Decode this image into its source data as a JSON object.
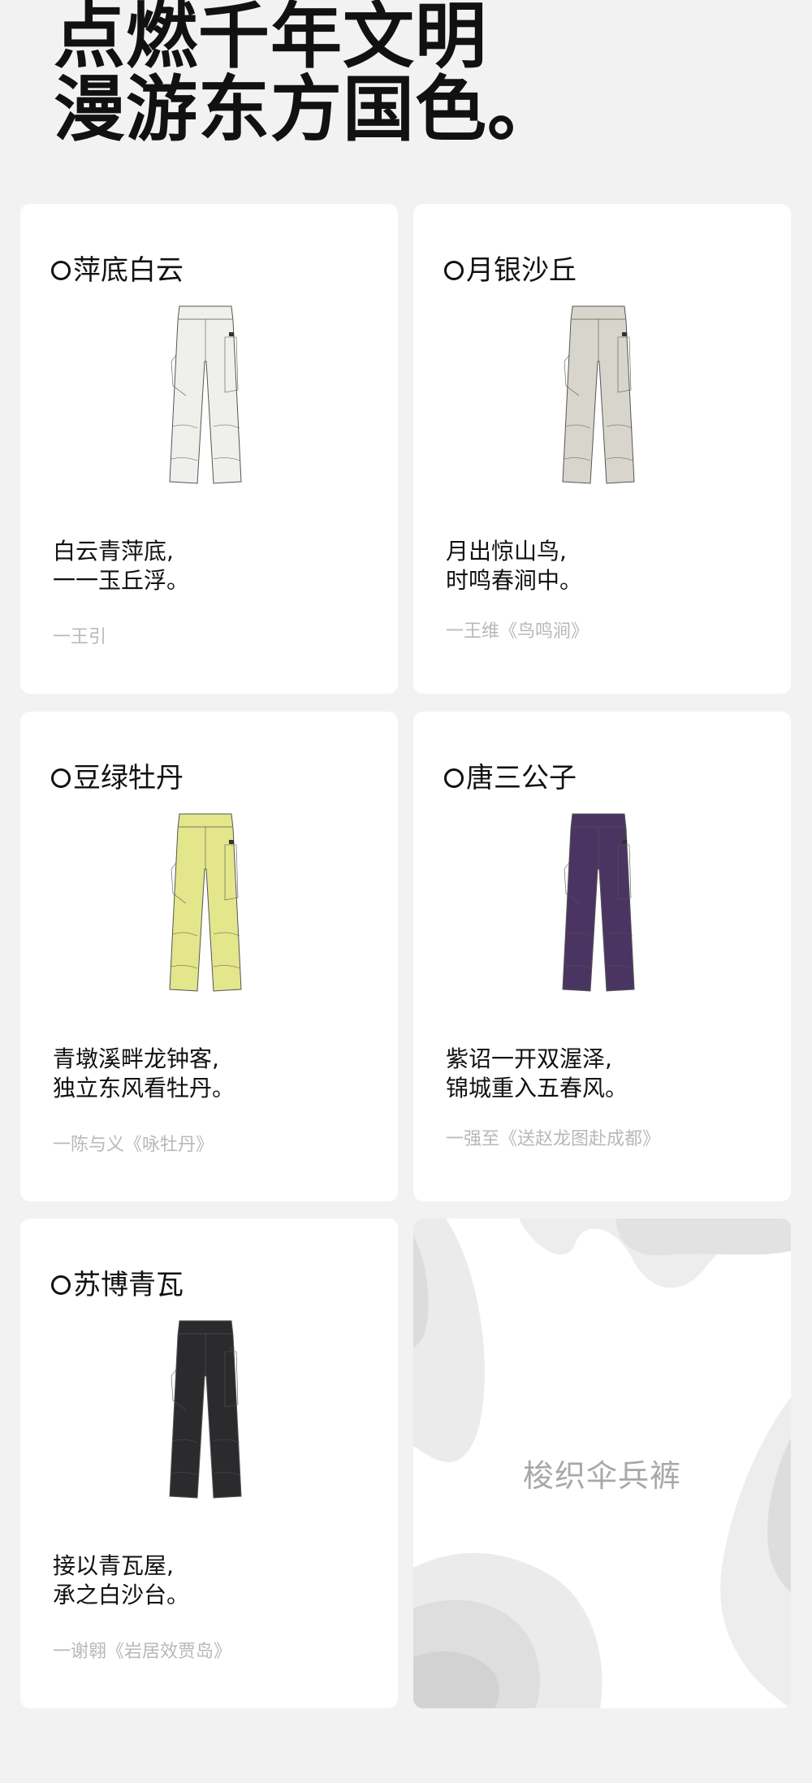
{
  "headline": {
    "line1": "点燃千年文明",
    "line2": "漫游东方国色。"
  },
  "cards": [
    {
      "title": "萍底白云",
      "color": "#efefeb",
      "poem_line1": "白云青萍底,",
      "poem_line2": "一一玉丘浮。",
      "credit": "一王引"
    },
    {
      "title": "月银沙丘",
      "color": "#d8d6cc",
      "poem_line1": "月出惊山鸟,",
      "poem_line2": "时鸣春涧中。",
      "credit": "一王维《鸟鸣涧》"
    },
    {
      "title": "豆绿牡丹",
      "color": "#e3e68a",
      "poem_line1": "青墩溪畔龙钟客,",
      "poem_line2": "独立东风看牡丹。",
      "credit": "一陈与义《咏牡丹》"
    },
    {
      "title": "唐三公子",
      "color": "#4a3562",
      "poem_line1": "紫诏一开双渥泽,",
      "poem_line2": "锦城重入五春风。",
      "credit": "一强至《送赵龙图赴成都》"
    },
    {
      "title": "苏博青瓦",
      "color": "#2b2b2d",
      "poem_line1": "接以青瓦屋,",
      "poem_line2": "承之白沙台。",
      "credit": "一谢翱《岩居效贾岛》"
    }
  ],
  "banner": {
    "text": "梭织伞兵裤"
  }
}
